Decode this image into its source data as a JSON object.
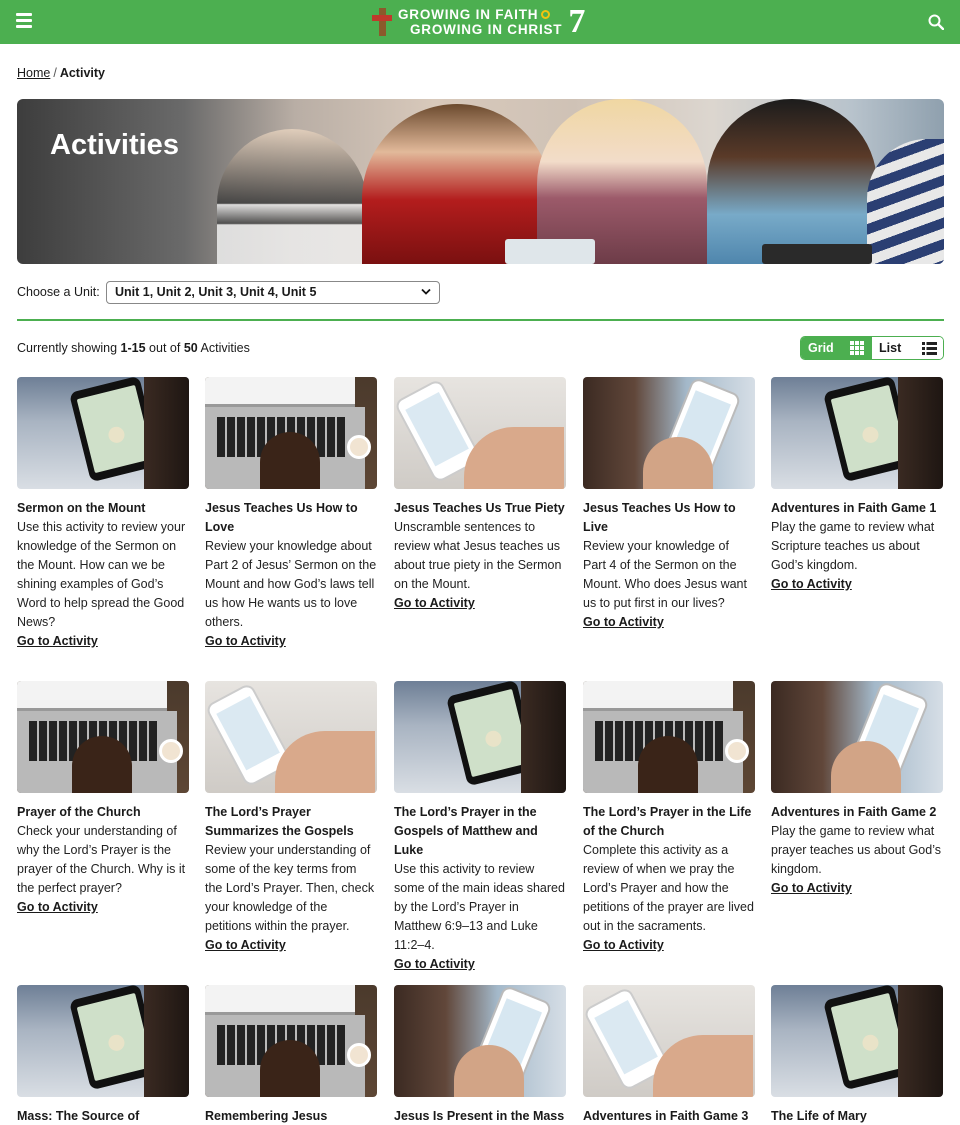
{
  "header": {
    "logo_line1": "GROWING IN FAITH",
    "logo_line2": "GROWING IN CHRIST",
    "logo_grade": "7",
    "brand_color": "#4caf50"
  },
  "breadcrumb": {
    "home": "Home",
    "separator": "/",
    "current": "Activity"
  },
  "hero": {
    "title": "Activities"
  },
  "filter": {
    "label": "Choose a Unit:",
    "selected": "Unit 1, Unit 2, Unit 3, Unit 4, Unit 5"
  },
  "results": {
    "prefix": "Currently showing",
    "range": "1-15",
    "middle": "out of",
    "total": "50",
    "suffix": "Activities"
  },
  "view_toggle": {
    "grid_label": "Grid",
    "list_label": "List",
    "active": "grid"
  },
  "cards": [
    {
      "title": "Sermon on the Mount",
      "desc": "Use this activity to review your knowledge of the Sermon on the Mount. How can we be shining examples of God’s Word to help spread the Good News?",
      "link": "Go to Activity",
      "thumb": "tablet"
    },
    {
      "title": "Jesus Teaches Us How to Love",
      "desc": "Review your knowledge about Part 2 of Jesus’ Sermon on the Mount and how God’s laws tell us how He wants us to love others.",
      "link": "Go to Activity",
      "thumb": "laptop"
    },
    {
      "title": "Jesus Teaches Us True Piety",
      "desc": "Unscramble sentences to review what Jesus teaches us about true piety in the Sermon on the Mount.",
      "link": "Go to Activity",
      "thumb": "phone"
    },
    {
      "title": "Jesus Teaches Us How to Live",
      "desc": "Review your knowledge of Part 4 of the Sermon on the Mount. Who does Jesus want us to put first in our lives?",
      "link": "Go to Activity",
      "thumb": "phone2"
    },
    {
      "title": "Adventures in Faith Game 1",
      "desc": "Play the game to review what Scripture teaches us about God’s kingdom.",
      "link": "Go to Activity",
      "thumb": "tablet"
    },
    {
      "title": "Prayer of the Church",
      "desc": "Check your understanding of why the Lord’s Prayer is the prayer of the Church. Why is it the perfect prayer?",
      "link": "Go to Activity",
      "thumb": "laptop"
    },
    {
      "title": "The Lord’s Prayer Summarizes the Gospels",
      "desc": "Review your understanding of some of the key terms from the Lord’s Prayer. Then, check your knowledge of the petitions within the prayer.",
      "link": "Go to Activity",
      "thumb": "phone"
    },
    {
      "title": "The Lord’s Prayer in the Gospels of Matthew and Luke",
      "desc": "Use this activity to review some of the main ideas shared by the Lord’s Prayer in Matthew 6:9–13 and Luke 11:2–4.",
      "link": "Go to Activity",
      "thumb": "tablet"
    },
    {
      "title": "The Lord’s Prayer in the Life of the Church",
      "desc": "Complete this activity as a review of when we pray the Lord’s Prayer and how the petitions of the prayer are lived out in the sacraments.",
      "link": "Go to Activity",
      "thumb": "laptop"
    },
    {
      "title": "Adventures in Faith Game 2",
      "desc": "Play the game to review what prayer teaches us about God’s kingdom.",
      "link": "Go to Activity",
      "thumb": "phone2"
    },
    {
      "title": "Mass: The Source of",
      "desc": "",
      "link": "",
      "thumb": "tablet"
    },
    {
      "title": "Remembering Jesus through",
      "desc": "",
      "link": "",
      "thumb": "laptop"
    },
    {
      "title": "Jesus Is Present in the Mass",
      "desc": "",
      "link": "",
      "thumb": "phone2"
    },
    {
      "title": "Adventures in Faith Game 3",
      "desc": "",
      "link": "",
      "thumb": "phone"
    },
    {
      "title": "The Life of Mary",
      "desc": "",
      "link": "",
      "thumb": "tablet"
    }
  ]
}
